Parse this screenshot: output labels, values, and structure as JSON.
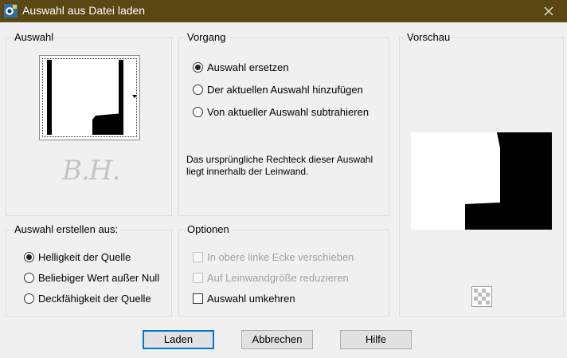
{
  "window": {
    "title": "Auswahl aus Datei laden",
    "title_bar_color": "#5a4712"
  },
  "groups": {
    "auswahl": {
      "label": "Auswahl"
    },
    "vorgang": {
      "label": "Vorgang",
      "options": [
        {
          "label": "Auswahl ersetzen",
          "checked": true
        },
        {
          "label": "Der aktuellen Auswahl hinzufügen",
          "checked": false
        },
        {
          "label": "Von aktueller Auswahl subtrahieren",
          "checked": false
        }
      ],
      "info": "Das ursprüngliche Rechteck dieser Auswahl liegt innerhalb der Leinwand."
    },
    "vorschau": {
      "label": "Vorschau"
    },
    "erstellen": {
      "label": "Auswahl erstellen aus:",
      "options": [
        {
          "label": "Helligkeit der Quelle",
          "checked": true
        },
        {
          "label": "Beliebiger Wert außer Null",
          "checked": false
        },
        {
          "label": "Deckfähigkeit der Quelle",
          "checked": false
        }
      ]
    },
    "optionen": {
      "label": "Optionen",
      "checks": [
        {
          "label": "In obere linke Ecke verschieben",
          "checked": false,
          "enabled": false
        },
        {
          "label": "Auf Leinwandgröße reduzieren",
          "checked": false,
          "enabled": false
        },
        {
          "label": "Auswahl umkehren",
          "checked": false,
          "enabled": true
        }
      ]
    }
  },
  "watermark": "B.H.",
  "buttons": {
    "load": "Laden",
    "cancel": "Abbrechen",
    "help": "Hilfe"
  },
  "icons": {
    "app": "app-icon",
    "close": "close-icon",
    "dropdown": "dropdown-arrow-icon",
    "transparency": "checkerboard-icon"
  }
}
